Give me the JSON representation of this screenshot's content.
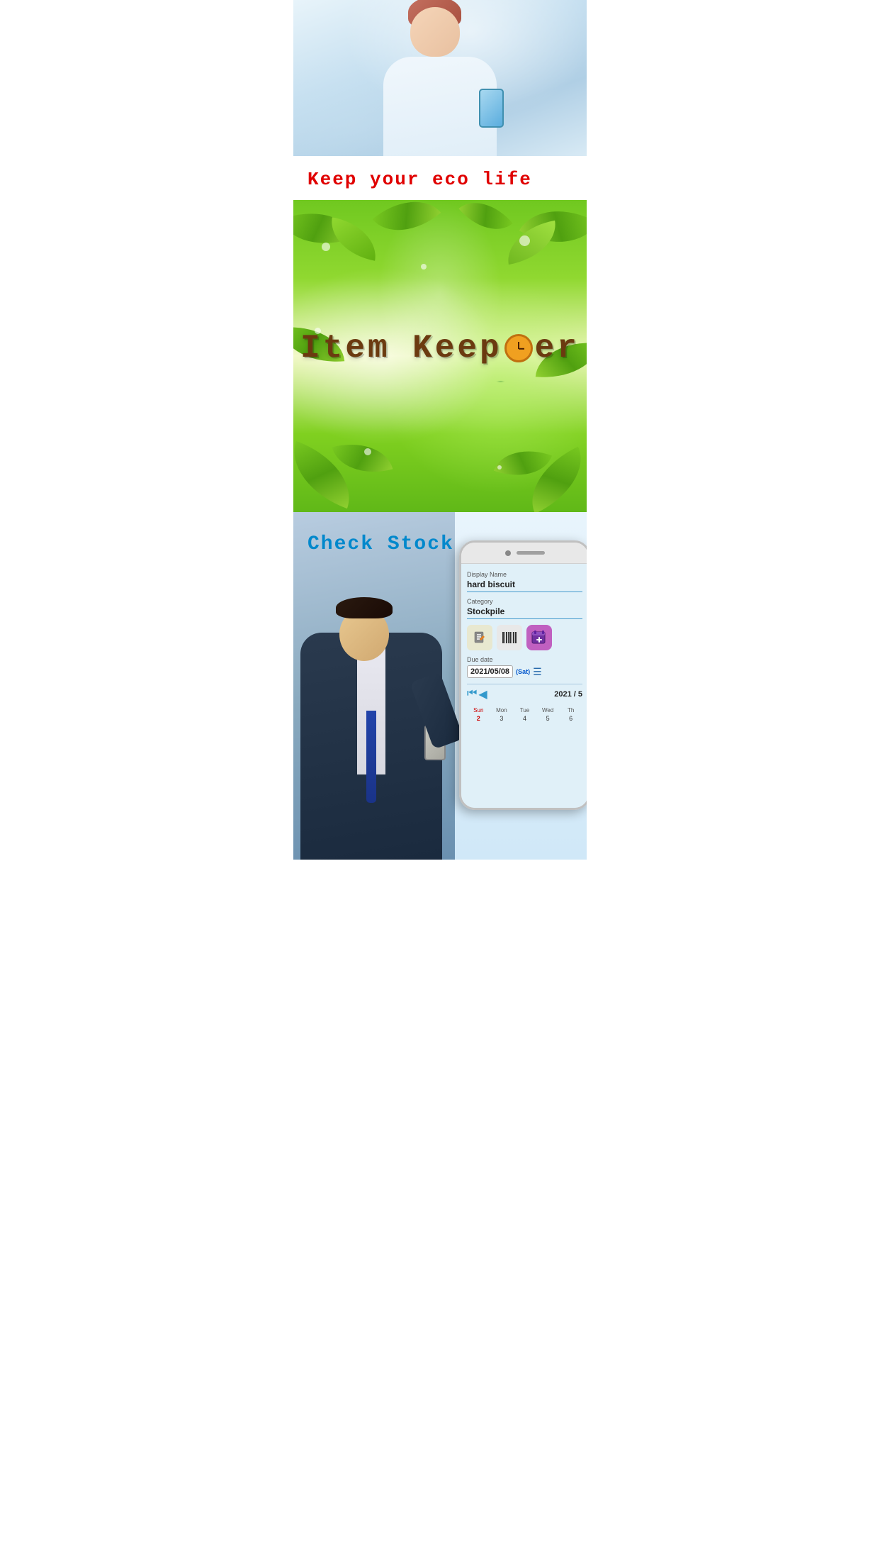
{
  "hero": {
    "alt": "Woman holding phone"
  },
  "tagline": {
    "text": "Keep your eco life"
  },
  "nature": {
    "app_name_part1": "Item Keep",
    "app_name_part2": "er"
  },
  "check_stock": {
    "label": "Check Stock"
  },
  "phone_ui": {
    "display_name_label": "Display Name",
    "display_name_value": "hard biscuit",
    "category_label": "Category",
    "category_value": "Stockpile",
    "due_date_label": "Due date",
    "due_date_value": "2021/05/08",
    "due_date_day": "(Sat)",
    "calendar_month": "2021 / 5",
    "days": [
      "Sun",
      "Mon",
      "Tue",
      "Wed",
      "Th"
    ],
    "calendar_nums": [
      "2",
      "3",
      "4",
      "5",
      "6"
    ]
  }
}
